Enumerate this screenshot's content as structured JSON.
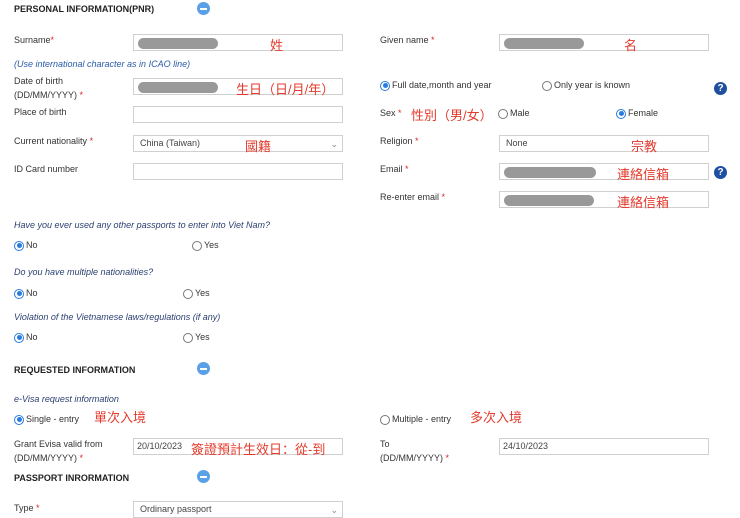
{
  "sections": {
    "personal": "PERSONAL INFORMATION(PNR)",
    "requested": "REQUESTED INFORMATION",
    "passport": "PASSPORT INRORMATION"
  },
  "personal": {
    "surname_label": "Surname",
    "surname_note": "姓",
    "icao_note": "(Use international character as in ICAO line)",
    "dob_label1": "Date of birth",
    "dob_label2": "(DD/MM/YYYY)",
    "dob_note": "生日（日/月/年）",
    "pob_label": "Place of birth",
    "nationality_label": "Current nationality",
    "nationality_value": "China (Taiwan)",
    "nationality_note": "國籍",
    "id_label": "ID Card number",
    "given_label": "Given name",
    "given_note": "名",
    "dob_full": "Full date,month and year",
    "dob_year": "Only year is known",
    "sex_label": "Sex",
    "sex_note": "性別（男/女）",
    "male": "Male",
    "female": "Female",
    "religion_label": "Religion",
    "religion_value": "None",
    "religion_note": "宗教",
    "email_label": "Email",
    "email_note": "連絡信箱",
    "reemail_label": "Re-enter email",
    "reemail_note": "連絡信箱",
    "help": "?",
    "star": "*"
  },
  "questions": [
    {
      "text": "Have you ever used any other passports to enter into Viet Nam?",
      "no": "No",
      "yes": "Yes"
    },
    {
      "text": "Do you have multiple nationalities?",
      "no": "No",
      "yes": "Yes"
    },
    {
      "text": "Violation of the Vietnamese laws/regulations (if any)",
      "no": "No",
      "yes": "Yes"
    }
  ],
  "requested": {
    "evisa_info": "e-Visa request information",
    "single": "Single - entry",
    "single_note": "單次入境",
    "multiple": "Multiple - entry",
    "multiple_note": "多次入境",
    "from_label1": "Grant Evisa valid from",
    "from_label2": "(DD/MM/YYYY)",
    "from_value": "20/10/2023",
    "from_note": "簽證預計生效日：從-到",
    "to_label1": "To",
    "to_label2": "(DD/MM/YYYY)",
    "to_value": "24/10/2023"
  },
  "passport": {
    "type_label": "Type",
    "type_value": "Ordinary passport"
  }
}
